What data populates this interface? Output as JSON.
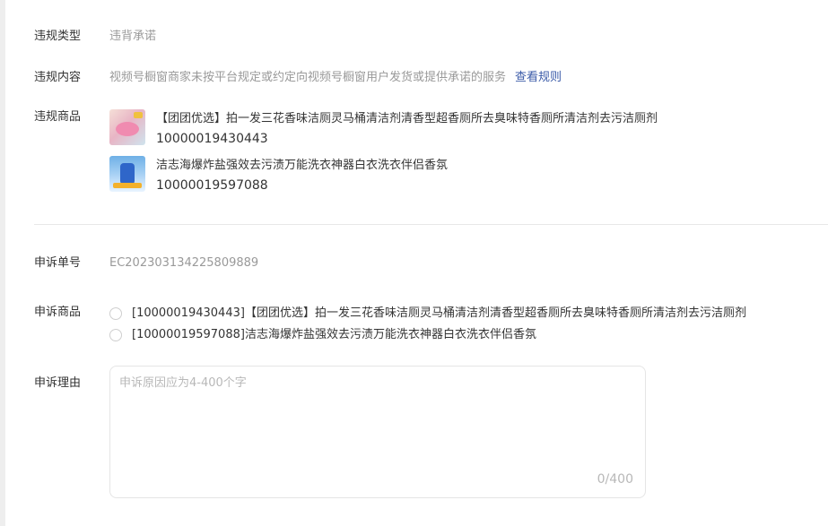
{
  "violation": {
    "type_label": "违规类型",
    "type_value": "违背承诺",
    "content_label": "违规内容",
    "content_value": "视频号橱窗商家未按平台规定或约定向视频号橱窗用户发货或提供承诺的服务",
    "rules_link": "查看规则",
    "goods_label": "违规商品",
    "goods": [
      {
        "title": "【团团优选】拍一发三花香味洁厕灵马桶清洁剂清香型超香厕所去臭味特香厕所清洁剂去污洁厕剂",
        "id": "10000019430443"
      },
      {
        "title": "洁志海爆炸盐强效去污渍万能洗衣神器白衣洗衣伴侣香氛",
        "id": "10000019597088"
      }
    ]
  },
  "appeal": {
    "number_label": "申诉单号",
    "number_value": "EC202303134225809889",
    "goods_label": "申诉商品",
    "goods_options": [
      "[10000019430443]【团团优选】拍一发三花香味洁厕灵马桶清洁剂清香型超香厕所去臭味特香厕所清洁剂去污洁厕剂",
      "[10000019597088]洁志海爆炸盐强效去污渍万能洗衣神器白衣洗衣伴侣香氛"
    ],
    "reason_label": "申诉理由",
    "reason_placeholder": "申诉原因应为4-400个字",
    "reason_counter": "0/400"
  }
}
